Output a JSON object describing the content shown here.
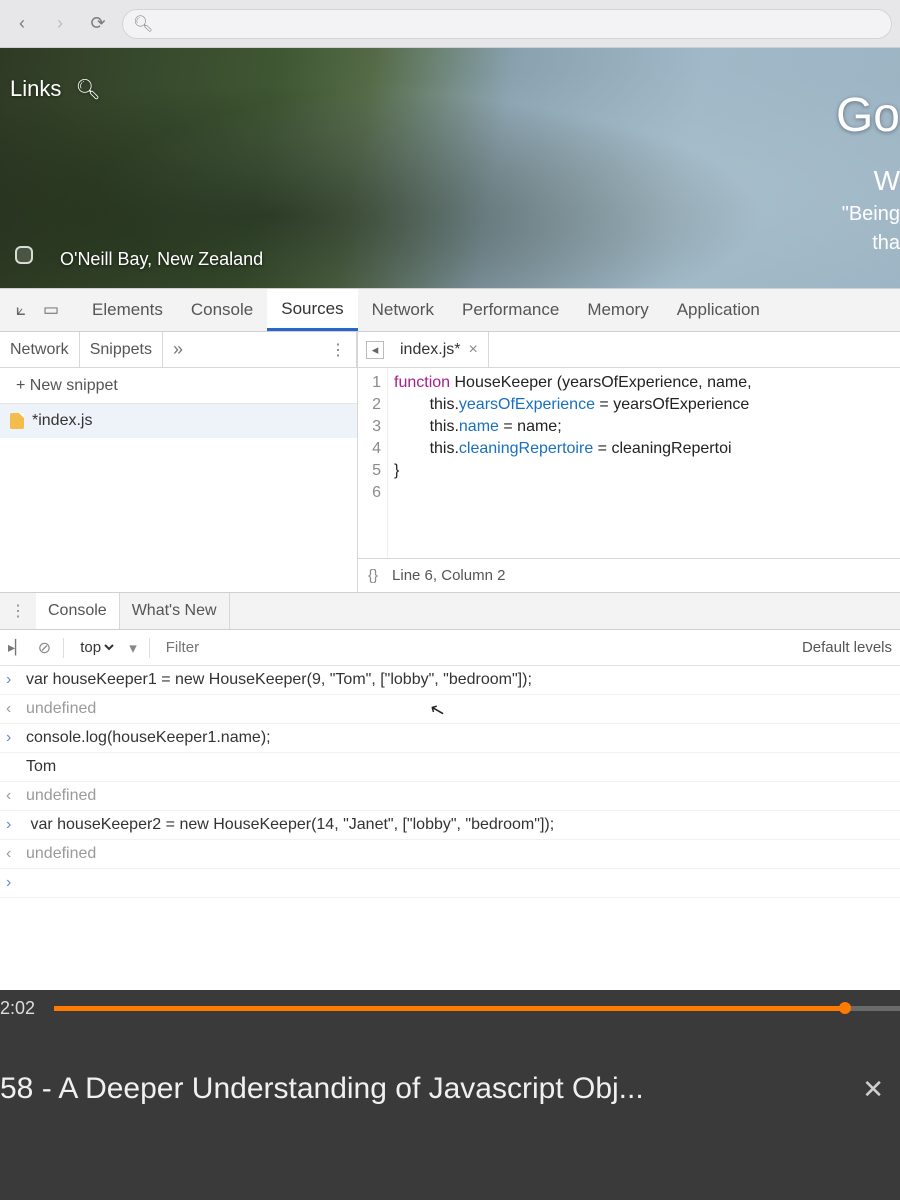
{
  "browser": {
    "url_placeholder": ""
  },
  "hero": {
    "links_label": "Links",
    "caption": "O'Neill Bay, New Zealand",
    "greeting": "Go",
    "sub1": "W",
    "quote": "\"Being",
    "quote2": "tha"
  },
  "devtools": {
    "tabs": [
      "Elements",
      "Console",
      "Sources",
      "Network",
      "Performance",
      "Memory",
      "Application"
    ],
    "active_tab": "Sources"
  },
  "navigator": {
    "tabs": [
      "Network",
      "Snippets"
    ],
    "more": "»",
    "new_snippet": "+ New snippet",
    "file": "*index.js"
  },
  "editor": {
    "open_file": "index.js*",
    "close": "×",
    "lines": [
      "1",
      "2",
      "3",
      "4",
      "5",
      "6"
    ],
    "code": {
      "l1": "",
      "l2_kw": "function",
      "l2_name": " HouseKeeper ",
      "l2_params": "(yearsOfExperience, name,",
      "l3a": "        this.",
      "l3b": "yearsOfExperience",
      "l3c": " = yearsOfExperience",
      "l4a": "        this.",
      "l4b": "name",
      "l4c": " = name;",
      "l5a": "        this.",
      "l5b": "cleaningRepertoire",
      "l5c": " = cleaningRepertoi",
      "l6": "}"
    },
    "status_braces": "{}",
    "status_pos": "Line 6, Column 2"
  },
  "drawer": {
    "tabs": [
      "Console",
      "What's New"
    ]
  },
  "console_toolbar": {
    "context": "top",
    "filter_placeholder": "Filter",
    "levels": "Default levels"
  },
  "console": {
    "l1": "var houseKeeper1 = new HouseKeeper(9, \"Tom\", [\"lobby\", \"bedroom\"]);",
    "undef": "undefined",
    "l2": "console.log(houseKeeper1.name);",
    "out1": "Tom",
    "l3": " var houseKeeper2 = new HouseKeeper(14, \"Janet\", [\"lobby\", \"bedroom\"]);"
  },
  "video": {
    "time": "2:02",
    "title": "58 - A Deeper Understanding of Javascript Obj..."
  }
}
